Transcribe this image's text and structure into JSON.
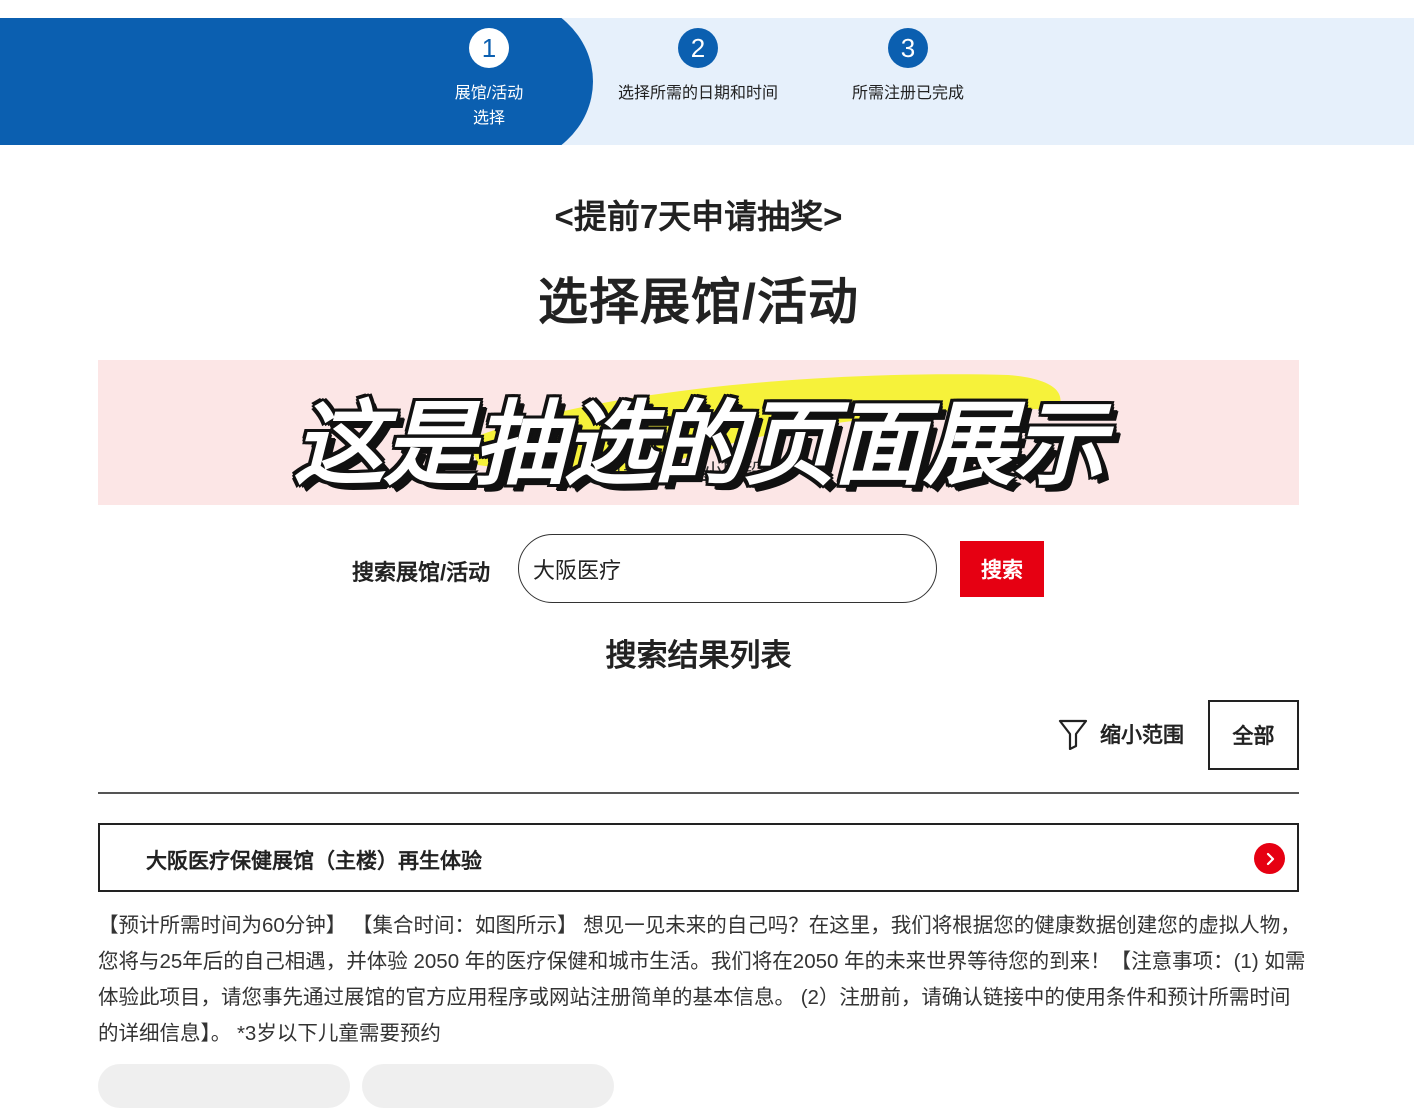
{
  "stepper": {
    "steps": [
      {
        "number": "1",
        "label_line1": "展馆/活动",
        "label_line2": "选择"
      },
      {
        "number": "2",
        "label_line1": "选择所需的日期和时间"
      },
      {
        "number": "3",
        "label_line1": "所需注册已完成"
      }
    ]
  },
  "header": {
    "subtitle": "<提前7天申请抽奖>",
    "title": "选择展馆/活动"
  },
  "overlay": {
    "caption": "这是抽选的页面展示",
    "hidden_text": "可选……段小时段"
  },
  "search": {
    "label": "搜索展馆/活动",
    "value": "大阪医疗",
    "button_label": "搜索"
  },
  "results": {
    "title": "搜索结果列表",
    "filter_label": "缩小范围",
    "all_button_label": "全部",
    "items": [
      {
        "title": "大阪医疗保健展馆（主楼）再生体验",
        "description": "【预计所需时间为60分钟】 【集合时间：如图所示】 想见一见未来的自己吗？在这里，我们将根据您的健康数据创建您的虚拟人物，您将与25年后的自己相遇，并体验 2050 年的医疗保健和城市生活。我们将在2050 年的未来世界等待您的到来！【注意事项：(1) 如需体验此项目，请您事先通过展馆的官方应用程序或网站注册简单的基本信息。 (2）注册前，请确认链接中的使用条件和预计所需时间的详细信息】。 *3岁以下儿童需要预约"
      }
    ]
  },
  "colors": {
    "primary_blue": "#0b5fb0",
    "light_blue": "#e6f0fb",
    "accent_red": "#e60012",
    "banner_pink": "#fce6e6",
    "highlight_yellow": "#f6f23a"
  },
  "icons": [
    "filter-funnel-icon",
    "chevron-right-icon"
  ]
}
